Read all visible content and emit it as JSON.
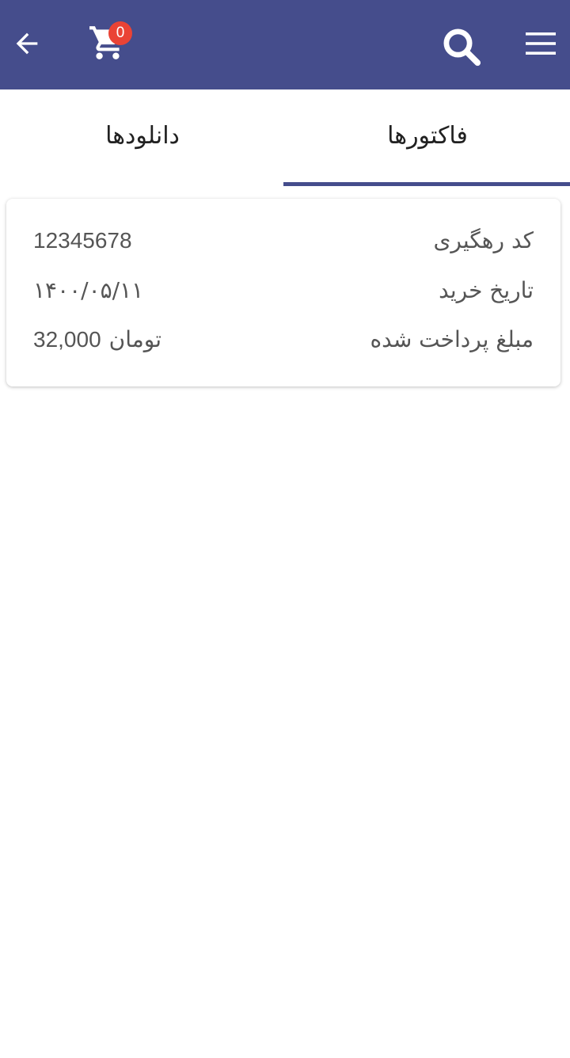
{
  "appbar": {
    "background": "#454d8c",
    "back_icon": "arrow-left-icon",
    "cart_icon": "shopping-cart-icon",
    "cart_count": "0",
    "search_icon": "search-icon",
    "menu_icon": "hamburger-menu-icon"
  },
  "tabs": [
    {
      "label": "فاکتورها",
      "selected": true
    },
    {
      "label": "دانلودها",
      "selected": false
    }
  ],
  "invoice": {
    "tracking_label": "کد رهگیری",
    "tracking_value": "12345678",
    "date_label": "تاریخ خرید",
    "date_value": "۱۴۰۰/۰۵/۱۱",
    "amount_label": "مبلغ پرداخت شده",
    "amount_value": "32,000",
    "amount_unit": "تومان"
  },
  "colors": {
    "primary": "#454d8c",
    "badge": "#ea4335",
    "text": "#555555"
  }
}
